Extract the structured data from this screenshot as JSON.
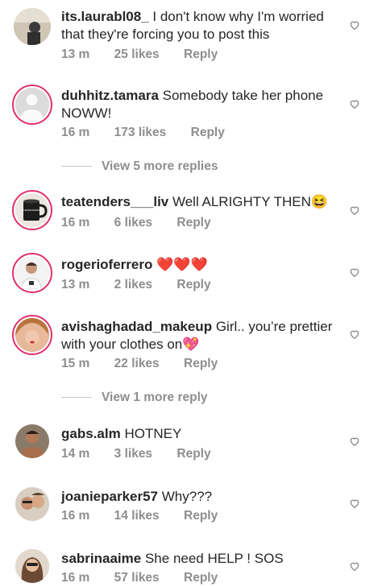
{
  "comments": [
    {
      "user": "its.laurabl08_",
      "text": "I don't know why I'm worried that they're forcing you to post this",
      "time": "13 m",
      "likes": "25 likes",
      "reply": "Reply"
    },
    {
      "user": "duhhitz.tamara",
      "text": "Somebody take her phone NOWW!",
      "time": "16 m",
      "likes": "173 likes",
      "reply": "Reply"
    },
    {
      "user": "teatenders___liv",
      "text": "Well ALRIGHTY THEN😆",
      "time": "16 m",
      "likes": "6 likes",
      "reply": "Reply"
    },
    {
      "user": "rogerioferrero",
      "text": "❤️❤️❤️",
      "time": "13 m",
      "likes": "2 likes",
      "reply": "Reply"
    },
    {
      "user": "avishaghadad_makeup",
      "text": "Girl.. you’re prettier with your clothes on💖",
      "time": "15 m",
      "likes": "22 likes",
      "reply": "Reply"
    },
    {
      "user": "gabs.alm",
      "text": "HOTNEY",
      "time": "14 m",
      "likes": "3 likes",
      "reply": "Reply"
    },
    {
      "user": "joanieparker57",
      "text": "Why???",
      "time": "16 m",
      "likes": "14 likes",
      "reply": "Reply"
    },
    {
      "user": "sabrinaaime",
      "text": "She need HELP ! SOS",
      "time": "16 m",
      "likes": "57 likes",
      "reply": "Reply"
    }
  ],
  "view_replies": [
    "View 5 more replies",
    "View 1 more reply"
  ],
  "mug_label": "TEATENDERS",
  "icons": {
    "like": "heart-outline-icon"
  }
}
